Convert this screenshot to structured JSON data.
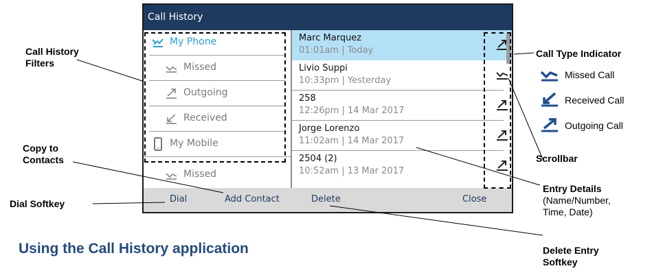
{
  "screen": {
    "title": "Call History",
    "filters": [
      {
        "label": "My Phone",
        "icon": "phone-received-icon",
        "active": true
      },
      {
        "label": "Missed",
        "icon": "missed-call-icon",
        "active": false
      },
      {
        "label": "Outgoing",
        "icon": "outgoing-call-icon",
        "active": false
      },
      {
        "label": "Received",
        "icon": "received-call-icon",
        "active": false
      },
      {
        "label": "My Mobile",
        "icon": "mobile-phone-icon",
        "active": false
      },
      {
        "label": "Missed",
        "icon": "missed-call-icon",
        "active": false
      }
    ],
    "entries": [
      {
        "name": "Marc Marquez",
        "details": "01:01am | Today",
        "icon": "outgoing-call-icon",
        "selected": true
      },
      {
        "name": "Livio Suppi",
        "details": "10:33pm | Yesterday",
        "icon": "missed-call-icon",
        "selected": false
      },
      {
        "name": "258",
        "details": "12:26pm | 14 Mar 2017",
        "icon": "outgoing-call-icon",
        "selected": false
      },
      {
        "name": "Jorge Lorenzo",
        "details": "11:02am | 14 Mar 2017",
        "icon": "outgoing-call-icon",
        "selected": false
      },
      {
        "name": "2504 (2)",
        "details": "10:52am | 13 Mar 2017",
        "icon": "outgoing-call-icon",
        "selected": false
      }
    ],
    "softkeys": {
      "dial": "Dial",
      "add_contact": "Add Contact",
      "delete": "Delete",
      "close": "Close"
    }
  },
  "callouts": {
    "filters": "Call History\nFilters",
    "copy": "Copy to\nContacts",
    "dial": "Dial Softkey",
    "type_indicator": "Call Type Indicator",
    "scrollbar": "Scrollbar",
    "entry_details_title": "Entry Details",
    "entry_details_sub": "(Name/Number,\nTime, Date)",
    "delete": "Delete Entry\nSoftkey"
  },
  "legend": [
    {
      "label": "Missed Call",
      "icon": "missed-call-icon"
    },
    {
      "label": "Received Call",
      "icon": "received-call-icon"
    },
    {
      "label": "Outgoing Call",
      "icon": "outgoing-call-icon"
    }
  ],
  "heading": "Using the Call History application",
  "colors": {
    "title_bar": "#1f3a5f",
    "active_filter": "#2a9fd6",
    "selected_row": "#b4e0f5",
    "softkey_bar": "#d9d9d9",
    "legend_icon": "#1f4f8f",
    "heading": "#264a7c"
  }
}
